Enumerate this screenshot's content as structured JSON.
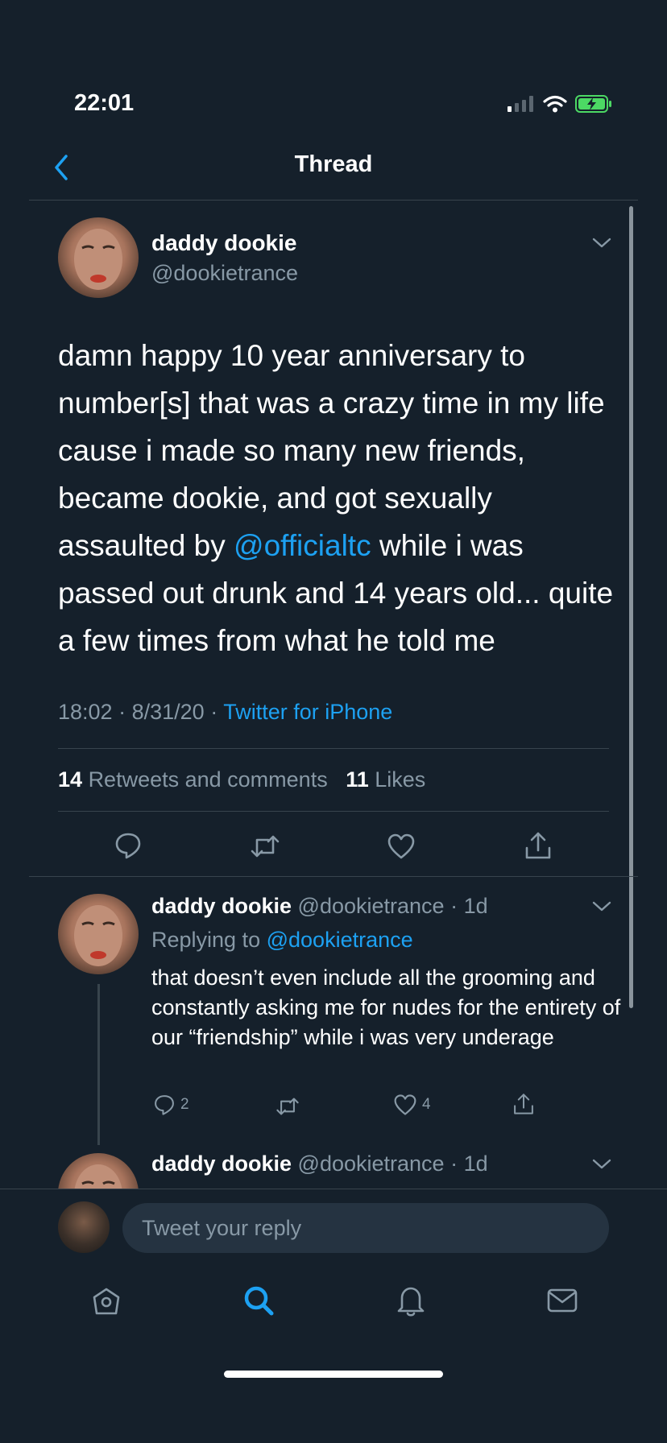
{
  "status_bar": {
    "time": "22:01"
  },
  "nav": {
    "title": "Thread"
  },
  "main_tweet": {
    "display_name": "daddy dookie",
    "handle": "@dookietrance",
    "text_before_mention": "damn happy 10 year anniversary to number[s] that was a crazy time in my life cause i made so many new friends, became dookie, and got sexually assaulted by ",
    "mention": "@officialtc",
    "text_after_mention": " while i was passed out drunk and 14 years old... quite a few times from what he told me",
    "time": "18:02",
    "date": "8/31/20",
    "source": "Twitter for iPhone",
    "retweets_count": "14",
    "retweets_label": "Retweets and comments",
    "likes_count": "11",
    "likes_label": "Likes"
  },
  "replies": [
    {
      "display_name": "daddy dookie",
      "handle": "@dookietrance",
      "age": "1d",
      "replying_label": "Replying to",
      "replying_to": "@dookietrance",
      "text": "that doesn’t even include all the grooming and constantly asking me for nudes for the entirety of our “friendship” while i was very underage",
      "reply_count": "2",
      "like_count": "4"
    },
    {
      "display_name": "daddy dookie",
      "handle": "@dookietrance",
      "age": "1d"
    }
  ],
  "composer": {
    "placeholder": "Tweet your reply"
  },
  "colors": {
    "background": "#15202b",
    "accent": "#1da1f2",
    "muted": "#8899a6",
    "divider": "#38444d",
    "battery": "#4cd964"
  }
}
